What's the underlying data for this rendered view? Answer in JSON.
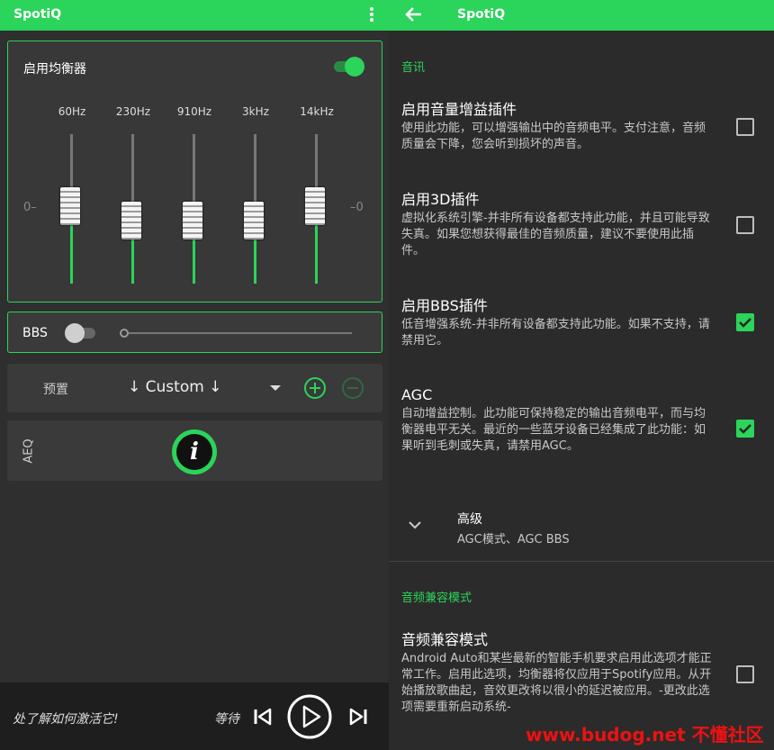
{
  "left": {
    "appbar": {
      "title": "SpotiQ"
    },
    "equalizer": {
      "label": "启用均衡器",
      "enabled": true,
      "zero_left": "0–",
      "zero_right": "–0",
      "bands": [
        {
          "freq": "60Hz",
          "level": 0.52
        },
        {
          "freq": "230Hz",
          "level": 0.42
        },
        {
          "freq": "910Hz",
          "level": 0.42
        },
        {
          "freq": "3kHz",
          "level": 0.42
        },
        {
          "freq": "14kHz",
          "level": 0.52
        }
      ]
    },
    "bbs": {
      "label": "BBS",
      "enabled": false,
      "level": 0
    },
    "preset": {
      "label": "预置",
      "value": "↓ Custom ↓"
    },
    "aeq": {
      "label": "AEQ",
      "icon": "info-icon"
    },
    "player": {
      "tip": "处了解如何激活它!",
      "status": "等待"
    },
    "colors": {
      "accent": "#2bd45a",
      "background": "#2f2f2f"
    }
  },
  "right": {
    "appbar": {
      "title": "SpotiQ"
    },
    "section_audio": "音讯",
    "items": [
      {
        "title": "启用音量增益插件",
        "desc": "使用此功能，可以增强输出中的音频电平。支付注意，音频质量会下降，您会听到损坏的声音。",
        "checked": false
      },
      {
        "title": "启用3D插件",
        "desc": "虚拟化系统引擎-并非所有设备都支持此功能，并且可能导致失真。如果您想获得最佳的音频质量，建议不要使用此插件。",
        "checked": false
      },
      {
        "title": "启用BBS插件",
        "desc": "低音增强系统-并非所有设备都支持此功能。如果不支持，请禁用它。",
        "checked": true
      },
      {
        "title": "AGC",
        "desc": "自动增益控制。此功能可保持稳定的输出音频电平，而与均衡器电平无关。最近的一些蓝牙设备已经集成了此功能：如果听到毛刺或失真，请禁用AGC。",
        "checked": true
      }
    ],
    "advanced": {
      "title": "高级",
      "subtitle": "AGC模式、AGC BBS"
    },
    "section_compat": "音频兼容模式",
    "compat": {
      "title": "音频兼容模式",
      "desc": "Android Auto和某些最新的智能手机要求启用此选项才能正常工作。启用此选项，均衡器将仅应用于Spotify应用。从开始播放歌曲起，音效更改将以很小的延迟被应用。-更改此选项需要重新启动系统-",
      "checked": false
    }
  },
  "watermark": "www.budog.net 不懂社区"
}
